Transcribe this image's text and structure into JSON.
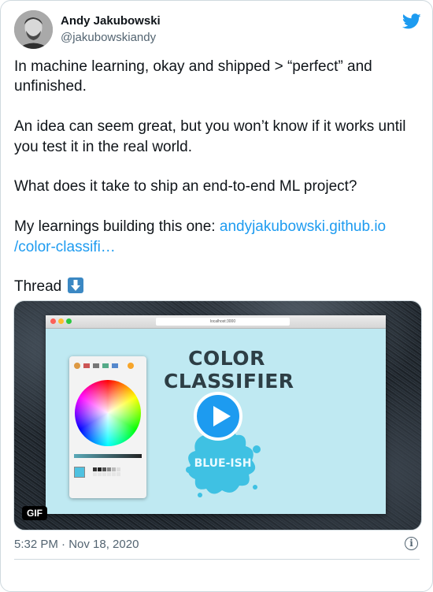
{
  "author": {
    "name": "Andy Jakubowski",
    "handle": "@jakubowskiandy"
  },
  "icons": {
    "brand": "twitter-bird-icon",
    "thread_emoji": "down-arrow-emoji",
    "info": "info-icon",
    "play": "play-icon"
  },
  "colors": {
    "link": "#1d9bf0",
    "play_button": "#1d9bf0",
    "secondary_text": "#536471"
  },
  "tweet": {
    "p1": "In machine learning, okay and shipped > “perfect” and unfinished.",
    "p2": "An idea can seem great, but you won’t know if it works until you test it in the real world.",
    "p3": "What does it take to ship an end-to-end ML project?",
    "p4_prefix": "My learnings building this one: ",
    "p4_link_line1": "andyjakubowski.github.io",
    "p4_link_line2": "/color-classifi…",
    "p5": "Thread"
  },
  "media": {
    "badge": "GIF",
    "browser_url": "localhost:3000",
    "app_title_line1": "COLOR",
    "app_title_line2": "CLASSIFIER",
    "result_label": "BLUE-ISH"
  },
  "footer": {
    "timestamp": "5:32 PM · Nov 18, 2020",
    "info_glyph": "i"
  }
}
